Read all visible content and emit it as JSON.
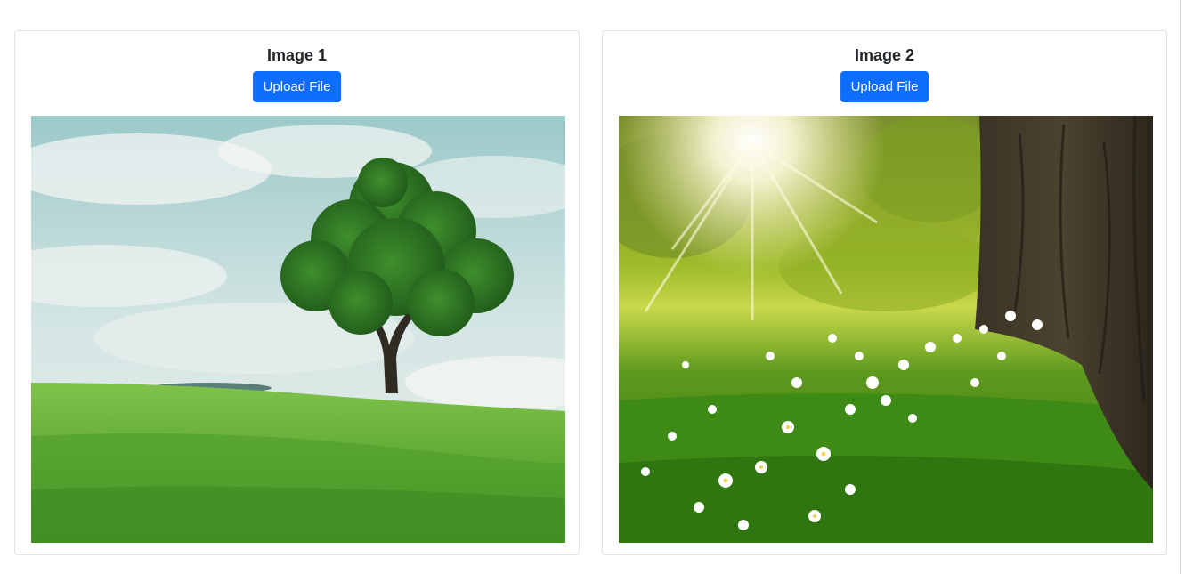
{
  "cards": [
    {
      "title": "Image 1",
      "button_label": "Upload File",
      "image_description": "lone tree on green grass hill under cloudy sky"
    },
    {
      "title": "Image 2",
      "button_label": "Upload File",
      "image_description": "sunlit meadow with white flowers beside a tree trunk"
    }
  ],
  "colors": {
    "accent": "#0d6efd",
    "card_border": "#dee2e6",
    "title_text": "#212529"
  }
}
